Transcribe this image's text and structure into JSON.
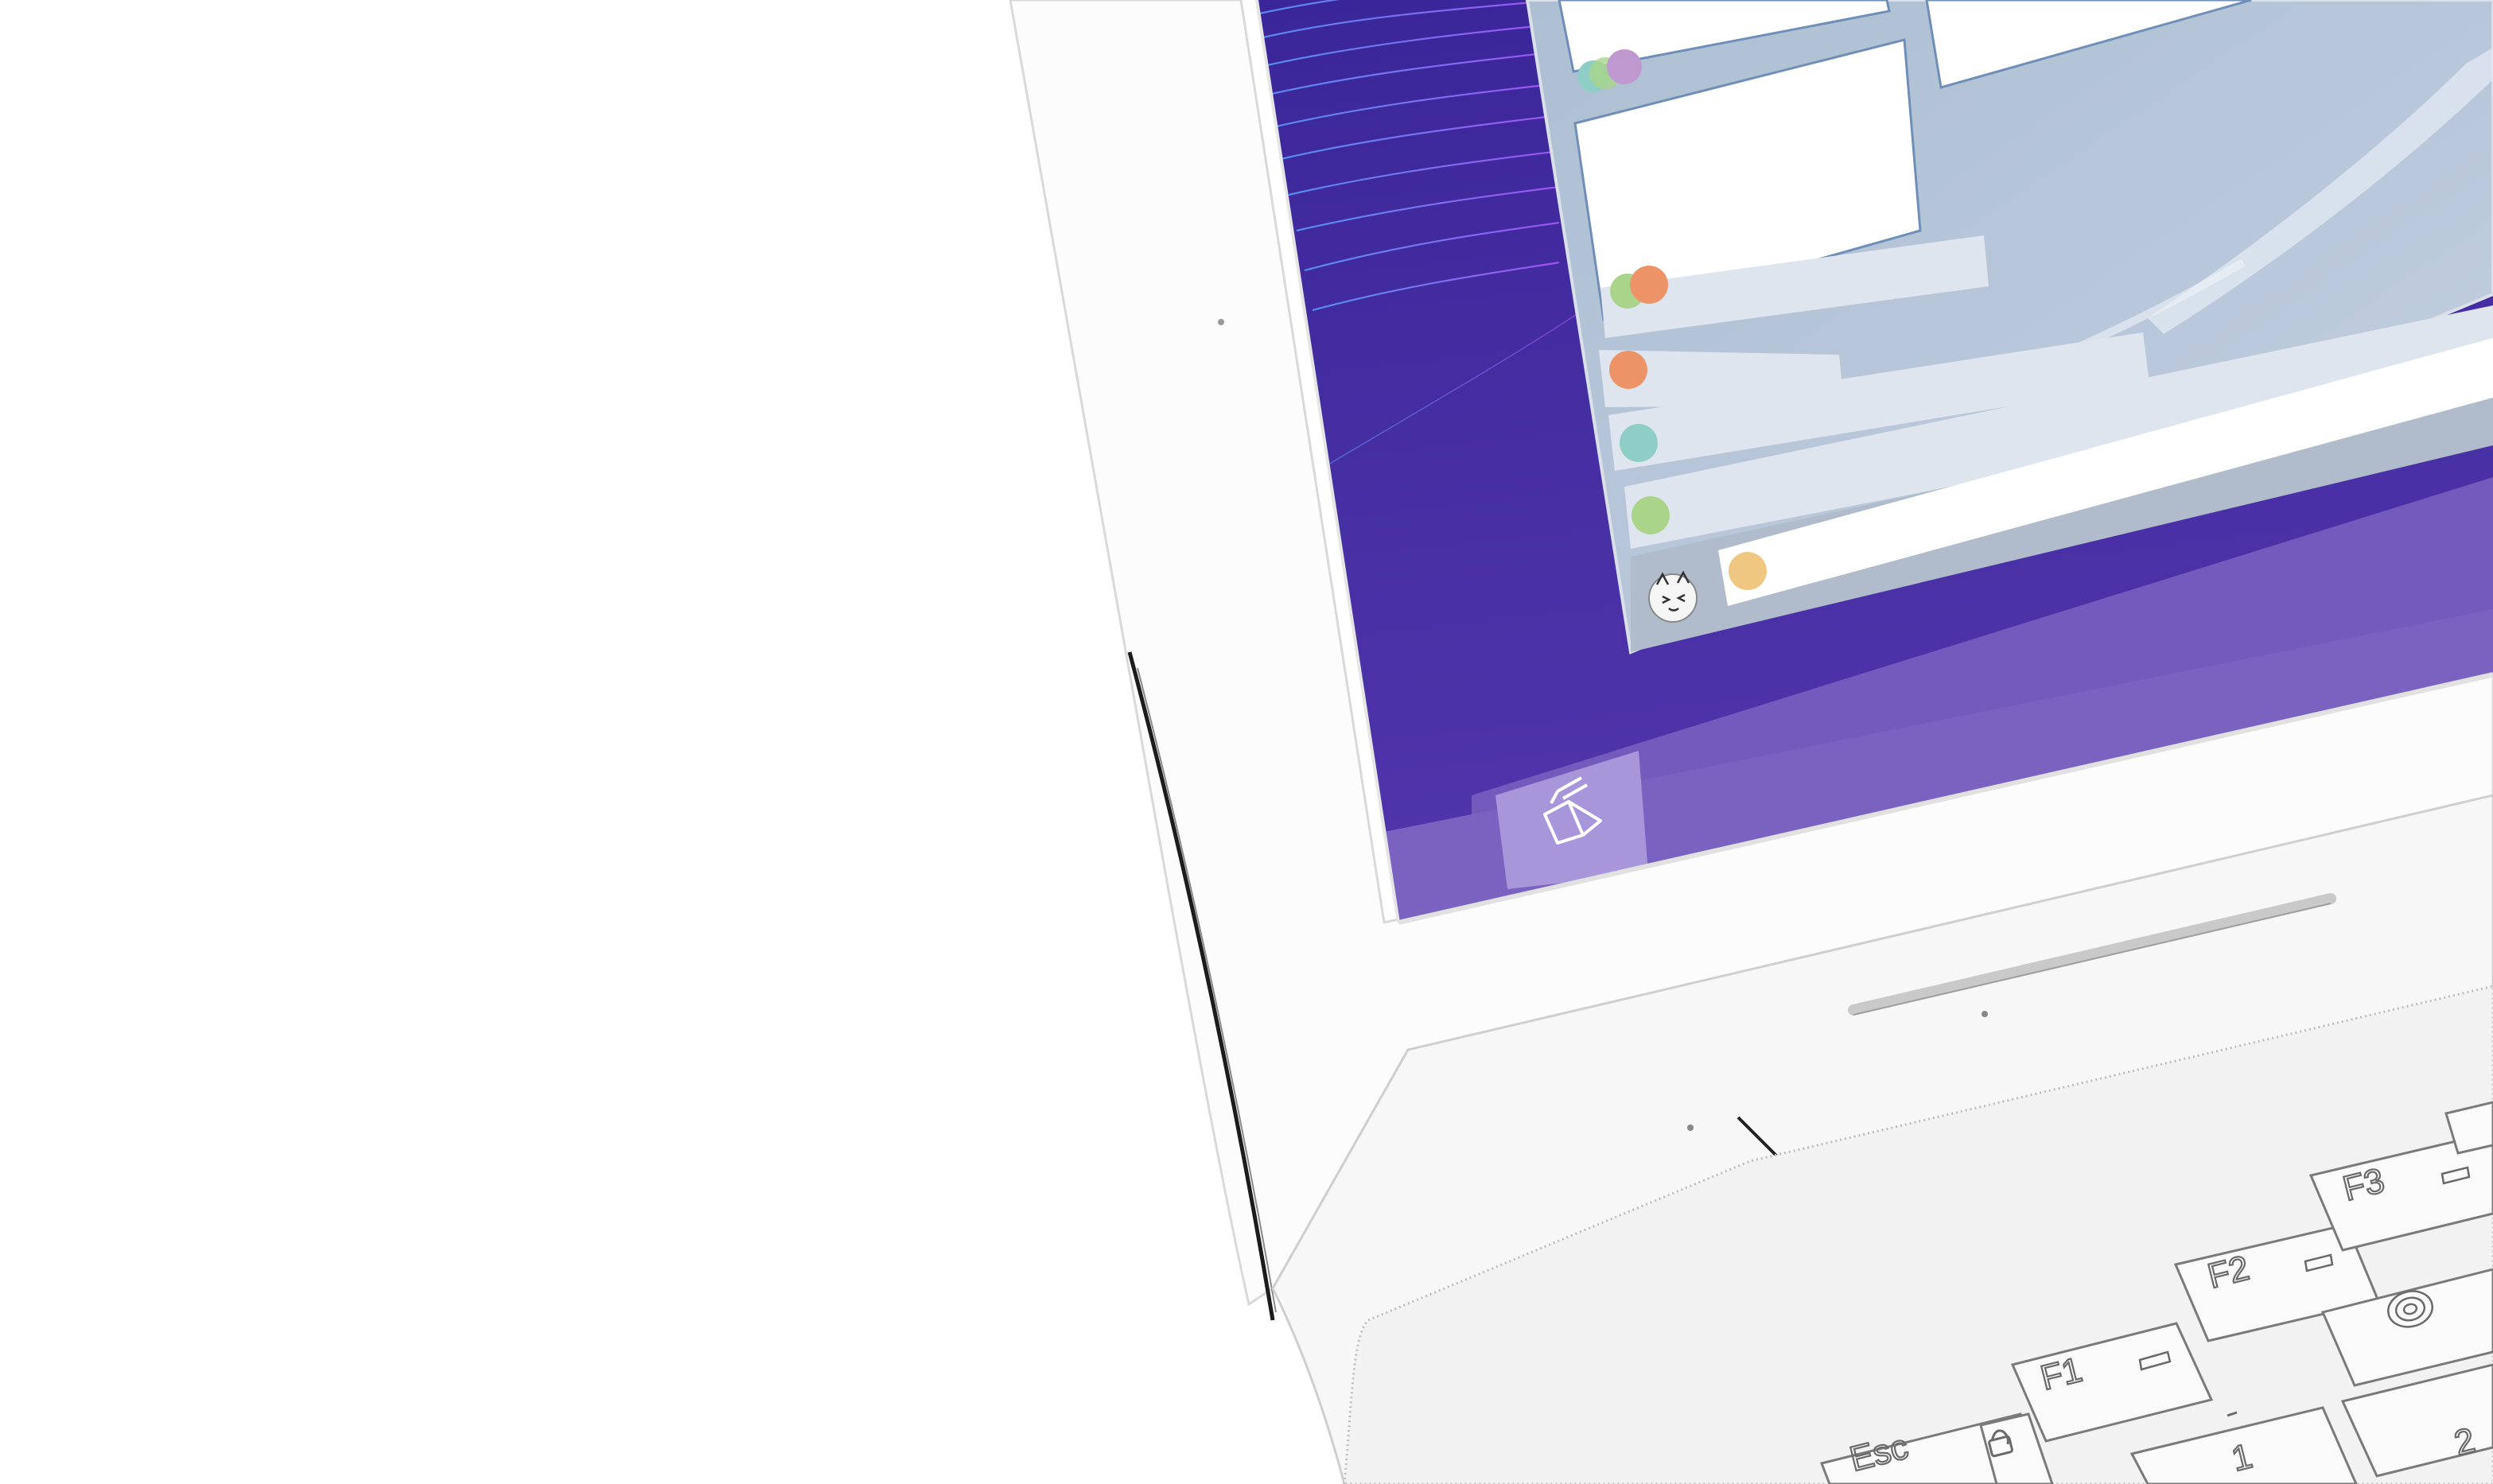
{
  "colors": {
    "desktop_top": "#3d2aa0",
    "desktop_bottom": "#5a3db0",
    "taskbar": "#7a62c0",
    "taskbar_active": "#a896da",
    "window_frame": "#aebfd3",
    "window_border": "#6f8fb8",
    "tile_white": "#ffffff",
    "list_item": "#dfe5ee",
    "laptop_body": "#fbfbfb",
    "laptop_edge": "#1c1c1c"
  },
  "icons": {
    "start": "folded-box-icon",
    "avatar": "cat-face-icon"
  },
  "dots": {
    "teal": "#8fcdc7",
    "lavender": "#c098d0",
    "green": "#a9d48a",
    "orange": "#ec9468",
    "yellow": "#f0c780"
  },
  "keyboard": {
    "keys": [
      {
        "id": "esc",
        "label": "Esc"
      },
      {
        "id": "f1",
        "label": "F1"
      },
      {
        "id": "f2",
        "label": "F2"
      },
      {
        "id": "f3",
        "label": "F3"
      },
      {
        "id": "lock",
        "label": ""
      },
      {
        "id": "one",
        "label": "1"
      },
      {
        "id": "two",
        "label": "2"
      },
      {
        "id": "fingerprint",
        "label": ""
      }
    ]
  }
}
